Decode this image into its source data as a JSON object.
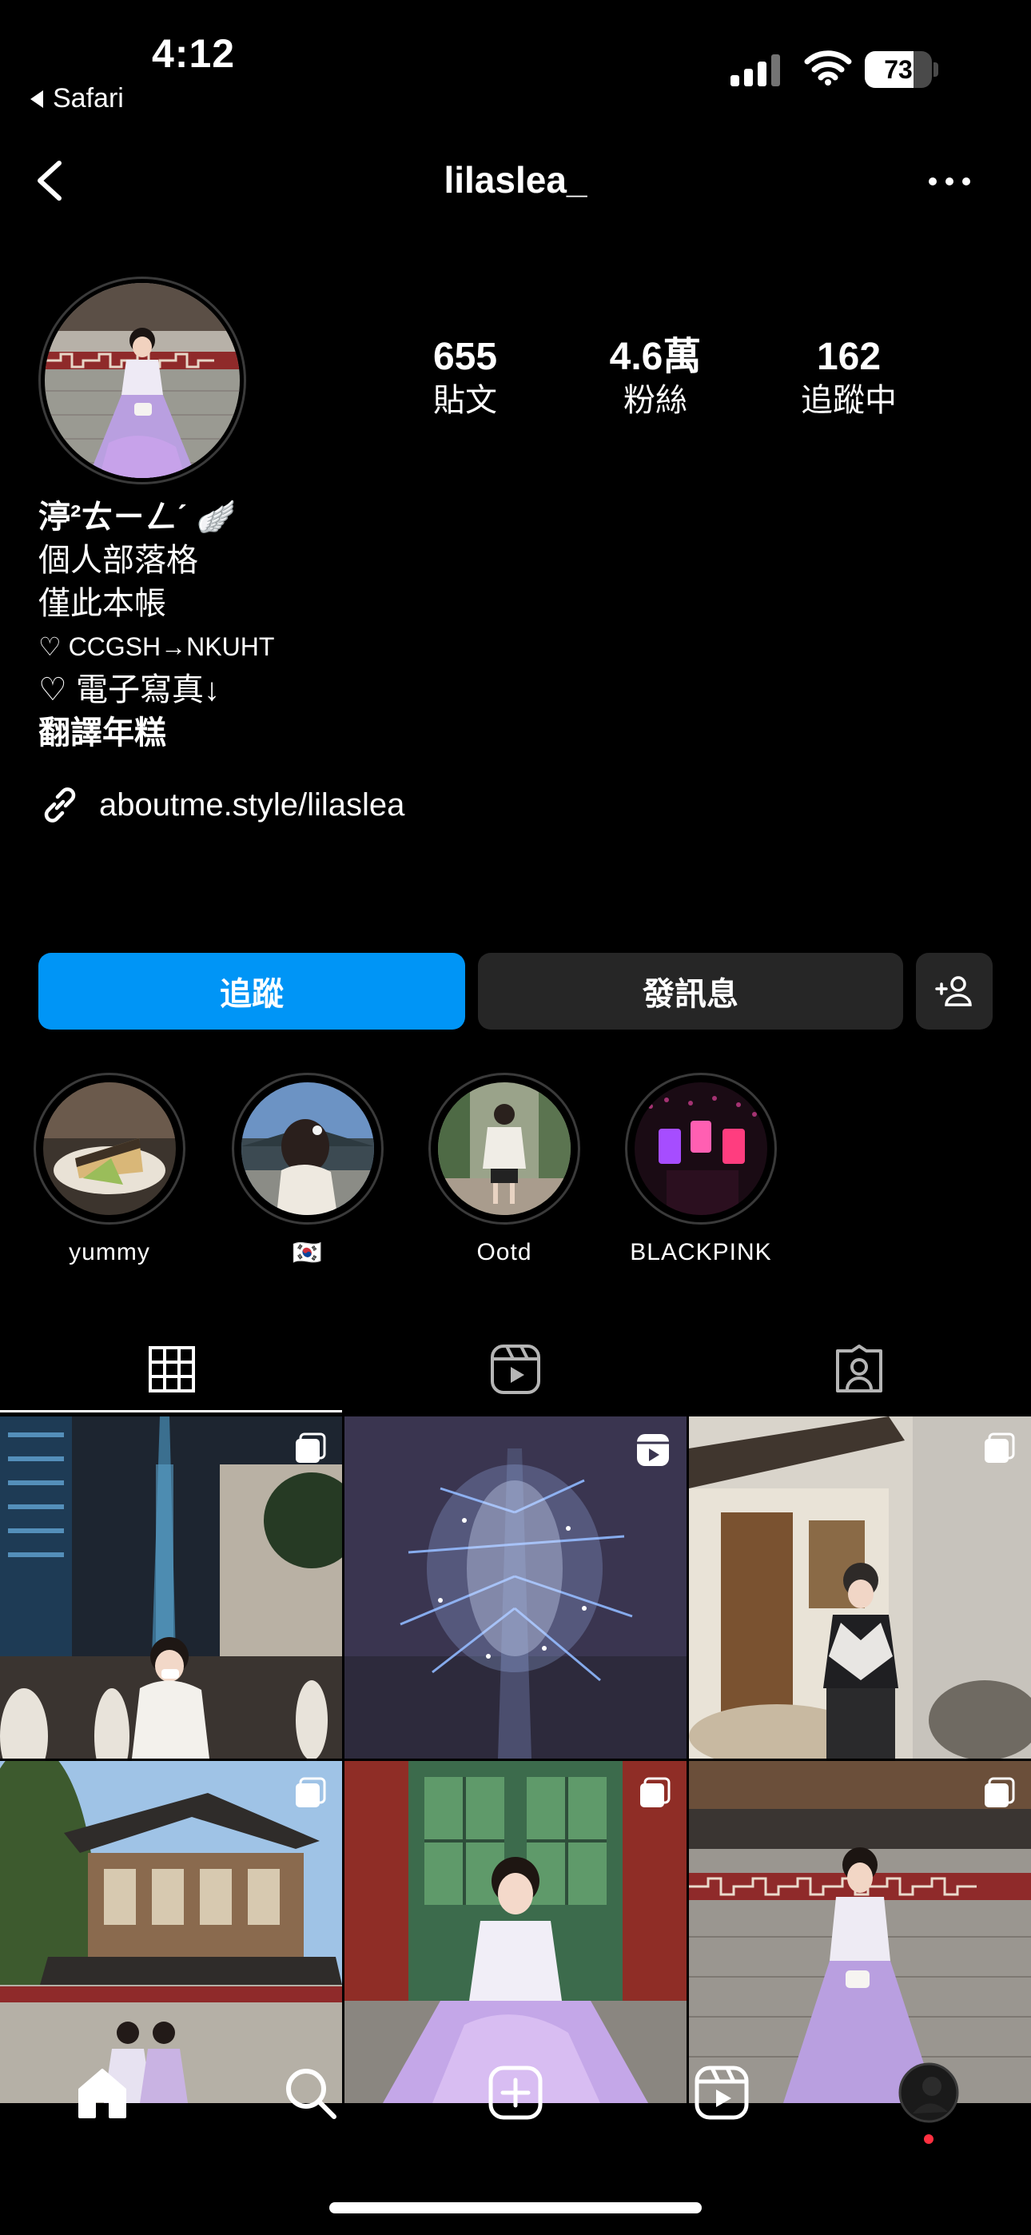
{
  "status_bar": {
    "time": "4:12",
    "back_app": "Safari",
    "battery": "73",
    "battery_level": 0.73
  },
  "header": {
    "username": "lilaslea_"
  },
  "profile": {
    "stats": [
      {
        "value": "655",
        "label": "貼文"
      },
      {
        "value": "4.6萬",
        "label": "粉絲"
      },
      {
        "value": "162",
        "label": "追蹤中"
      }
    ],
    "bio": {
      "name": "渟²ㄊㄧㄥˊ 🪽",
      "line1": "個人部落格",
      "line2": "僅此本帳",
      "line3": "♡ CCGSH→NKUHT",
      "line4": "♡ 電子寫真↓",
      "line5": "翻譯年糕"
    },
    "link": "aboutme.style/lilaslea"
  },
  "actions": {
    "follow": "追蹤",
    "message": "發訊息"
  },
  "highlights": [
    {
      "label": "yummy"
    },
    {
      "label": "🇰🇷"
    },
    {
      "label": "Ootd"
    },
    {
      "label": "BLACKPINK"
    }
  ],
  "tabs": [
    {
      "icon": "grid-icon"
    },
    {
      "icon": "reels-icon"
    },
    {
      "icon": "tagged-icon"
    }
  ],
  "posts": [
    {
      "subject": "Taipei 101 night crowd",
      "badge": "carousel"
    },
    {
      "subject": "Taipei 101 fireworks",
      "badge": "reel"
    },
    {
      "subject": "hanok alley outfit",
      "badge": "carousel"
    },
    {
      "subject": "palace pavilion",
      "badge": "carousel"
    },
    {
      "subject": "hanbok green door",
      "badge": "carousel"
    },
    {
      "subject": "hanbok stone wall",
      "badge": "carousel"
    }
  ],
  "bottom_nav": [
    {
      "icon": "home-icon"
    },
    {
      "icon": "search-icon"
    },
    {
      "icon": "create-icon"
    },
    {
      "icon": "reels-icon"
    },
    {
      "icon": "profile-avatar"
    }
  ],
  "colors": {
    "accent": "#0095f6",
    "button_dark": "#262626",
    "notification": "#ff3040",
    "background": "#000000"
  }
}
